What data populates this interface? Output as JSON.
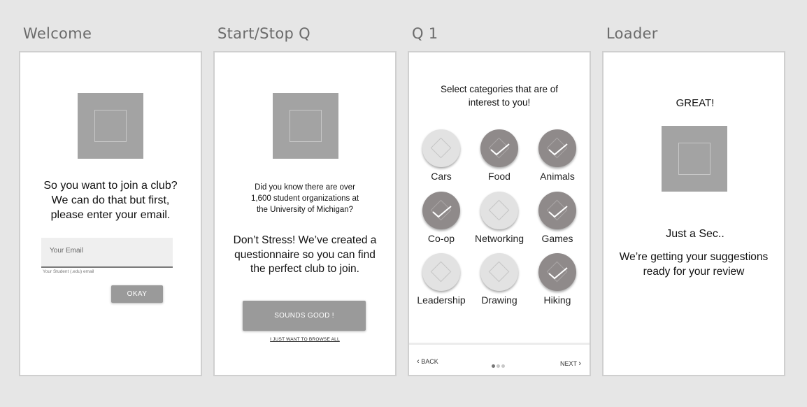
{
  "labels": {
    "welcome": "Welcome",
    "start_stop": "Start/Stop Q",
    "q1": "Q 1",
    "loader": "Loader"
  },
  "welcome": {
    "question": "So you want to join a club? We can do that but first, please enter your email.",
    "email_placeholder": "Your Email",
    "email_helper": "Your Student (.edu) email",
    "okay_button": "OKAY",
    "image_placeholder_icon": "image-placeholder-icon"
  },
  "start_stop": {
    "fact": "Did you know there are over 1,600 student organizations at the University of Michigan?",
    "stress": "Don’t Stress! We’ve created a questionnaire so you can find the perfect club to join.",
    "sounds_good_button": "SOUNDS GOOD !",
    "browse_link": "I JUST WANT TO BROWSE ALL"
  },
  "q1": {
    "title": "Select categories that are of interest to you!",
    "categories": [
      {
        "name": "Cars",
        "selected": false
      },
      {
        "name": "Food",
        "selected": true
      },
      {
        "name": "Animals",
        "selected": true
      },
      {
        "name": "Co-op",
        "selected": true
      },
      {
        "name": "Networking",
        "selected": false
      },
      {
        "name": "Games",
        "selected": true
      },
      {
        "name": "Leadership",
        "selected": false
      },
      {
        "name": "Drawing",
        "selected": false
      },
      {
        "name": "Hiking",
        "selected": true
      }
    ],
    "back": "BACK",
    "next": "NEXT",
    "page_dots": 3,
    "current_page": 1
  },
  "loader": {
    "great": "GREAT!",
    "just_a_sec": "Just a Sec..",
    "message": "We’re getting your suggestions ready for your review"
  },
  "colors": {
    "background": "#e6e6e6",
    "placeholder": "#a3a3a3",
    "button": "#9a9a9a",
    "selected_circle": "#8f8a8a",
    "unselected_circle": "#e2e2e2"
  }
}
